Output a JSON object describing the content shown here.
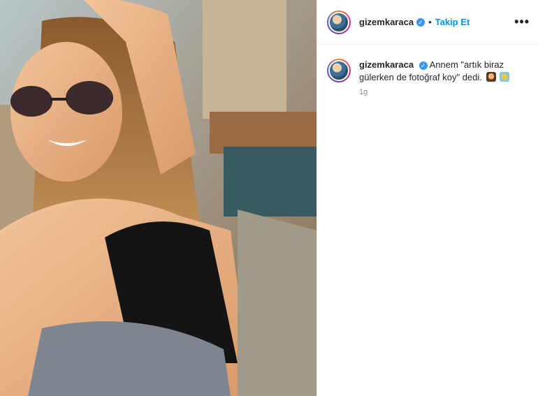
{
  "post": {
    "username": "gizemkaraca",
    "verified_icon": "verified-badge-icon",
    "follow_label": "Takip Et",
    "more_icon": "more-options-icon",
    "more_glyph": "•••",
    "caption": {
      "username": "gizemkaraca",
      "text": "Annem \"artık biraz gülerken de fotoğraf koy\" dedi.",
      "emojis": [
        "woman-gesturing-icon",
        "woman-raising-hand-icon"
      ]
    },
    "timestamp": "1g"
  },
  "colors": {
    "accent": "#0095f6",
    "text": "#262626",
    "muted": "#8e8e8e",
    "verified": "#3897f0"
  }
}
